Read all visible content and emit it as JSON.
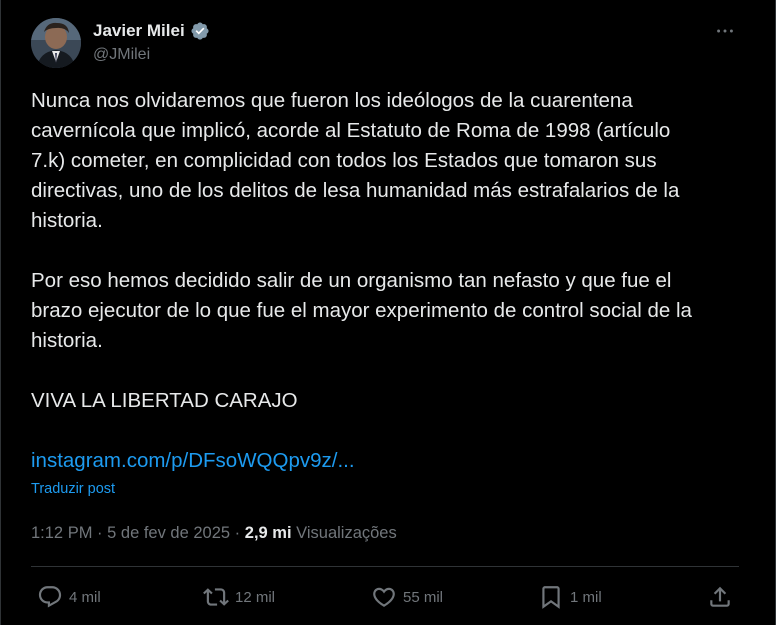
{
  "author": {
    "display_name": "Javier Milei",
    "handle": "@JMilei",
    "verified": true,
    "avatar_icon": "profile-photo"
  },
  "tweet": {
    "paragraphs": [
      "Nunca nos olvidaremos que fueron los ideólogos de la cuarentena\ncavernícola que implicó, acorde al Estatuto de Roma de 1998 (artículo\n7.k) cometer, en complicidad con todos los Estados que tomaron sus\ndirectivas, uno de los delitos de lesa humanidad más estrafalarios de la\nhistoria.",
      "Por eso hemos decidido salir de un organismo tan nefasto y que fue el\nbrazo ejecutor de lo que fue el mayor experimento de control social de la\nhistoria.",
      "VIVA LA LIBERTAD CARAJO"
    ],
    "link": "instagram.com/p/DFsoWQQpv9z/...",
    "translate_label": "Traduzir post"
  },
  "meta": {
    "time": "1:12 PM",
    "separator": "·",
    "date": "5 de fev de 2025",
    "views_count": "2,9 mi",
    "views_label": "Visualizações"
  },
  "actions": {
    "replies": "4 mil",
    "reposts": "12 mil",
    "likes": "55 mil",
    "bookmarks": "1 mil"
  },
  "colors": {
    "background": "#000000",
    "text": "#e7e9ea",
    "secondary": "#71767b",
    "link": "#1d9bf0",
    "verified": "#829aab",
    "border": "#2f3336"
  },
  "icons": {
    "more": "more-horizontal-icon",
    "reply": "reply-icon",
    "repost": "repost-icon",
    "like": "heart-icon",
    "bookmark": "bookmark-icon",
    "share": "share-icon"
  }
}
